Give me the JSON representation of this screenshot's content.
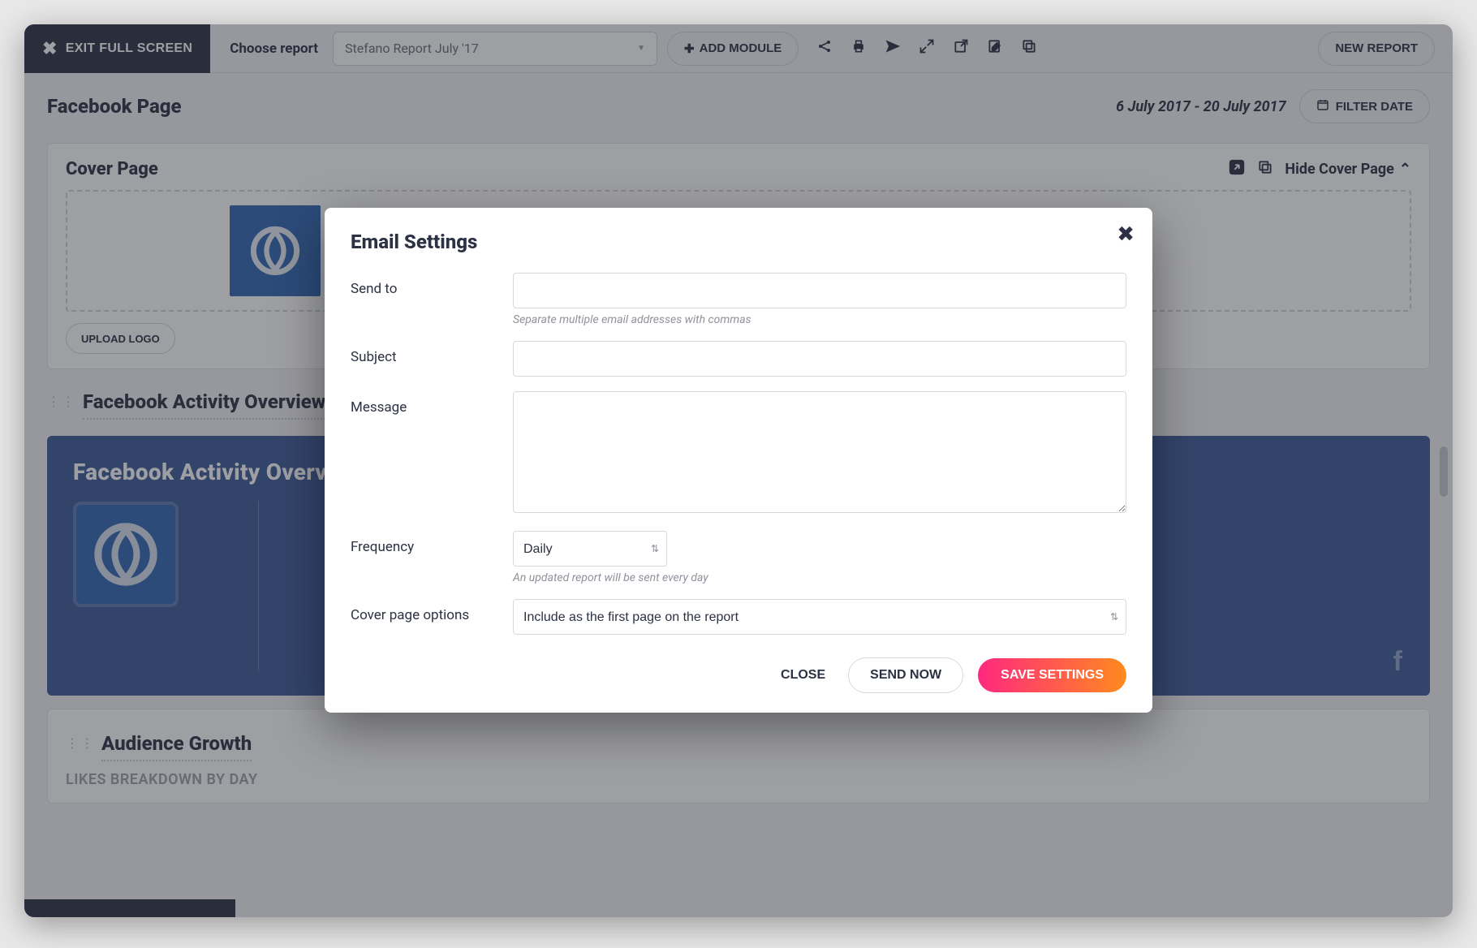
{
  "toolbar": {
    "exit_label": "EXIT FULL SCREEN",
    "choose_label": "Choose report",
    "report_name": "Stefano Report July '17",
    "add_module_label": "ADD MODULE",
    "new_report_label": "NEW REPORT"
  },
  "subheader": {
    "page_title": "Facebook Page",
    "date_range": "6 July 2017 - 20 July 2017",
    "filter_date_label": "FILTER DATE"
  },
  "cover_card": {
    "title": "Cover Page",
    "hide_label": "Hide Cover Page",
    "upload_label": "UPLOAD LOGO"
  },
  "activity_section": {
    "heading": "Facebook Activity Overview",
    "banner_title": "Facebook Activity Overview"
  },
  "audience_section": {
    "heading": "Audience Growth",
    "subtext": "LIKES BREAKDOWN BY DAY"
  },
  "modal": {
    "title": "Email Settings",
    "labels": {
      "send_to": "Send to",
      "subject": "Subject",
      "message": "Message",
      "frequency": "Frequency",
      "cover_options": "Cover page options"
    },
    "helpers": {
      "send_to": "Separate multiple email addresses with commas",
      "frequency": "An updated report will be sent every day"
    },
    "frequency_value": "Daily",
    "cover_value": "Include as the first page on the report",
    "buttons": {
      "close": "CLOSE",
      "send_now": "SEND NOW",
      "save": "SAVE SETTINGS"
    }
  }
}
